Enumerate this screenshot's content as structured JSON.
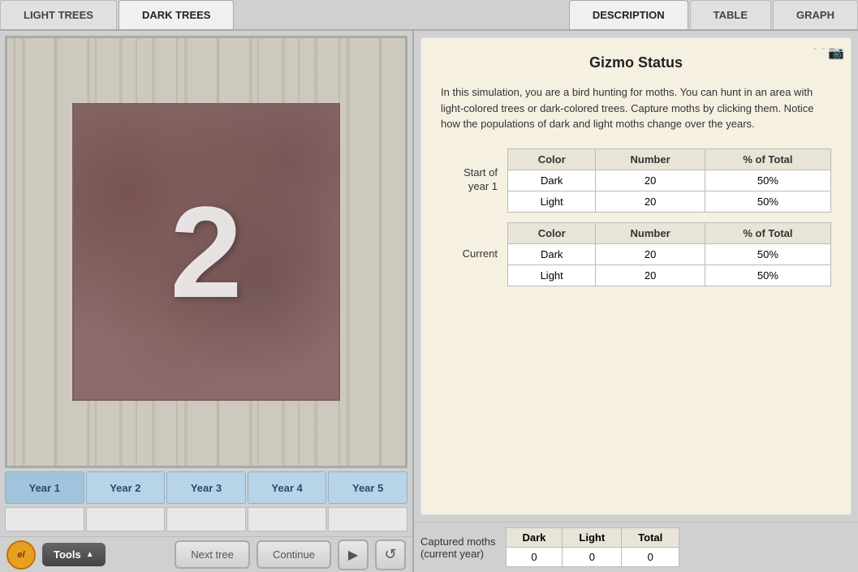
{
  "tabs": {
    "left": [
      {
        "label": "LIGHT TREES",
        "active": false
      },
      {
        "label": "DARK TREES",
        "active": true
      }
    ],
    "right": [
      {
        "label": "DESCRIPTION",
        "active": true
      },
      {
        "label": "TABLE",
        "active": false
      },
      {
        "label": "GRAPH",
        "active": false
      }
    ]
  },
  "display": {
    "current_year": "2"
  },
  "year_tabs": [
    {
      "label": "Year 1"
    },
    {
      "label": "Year 2"
    },
    {
      "label": "Year 3"
    },
    {
      "label": "Year 4"
    },
    {
      "label": "Year 5"
    }
  ],
  "controls": {
    "next_tree": "Next tree",
    "continue": "Continue",
    "tools": "Tools"
  },
  "description": {
    "title": "Gizmo Status",
    "body": "In this simulation, you are a bird hunting for moths. You can hunt in an area with light-colored trees or dark-colored trees. Capture moths by clicking them. Notice how the populations of dark and light moths change over the years."
  },
  "start_table": {
    "label": "Start of\nyear 1",
    "headers": [
      "Color",
      "Number",
      "% of Total"
    ],
    "rows": [
      [
        "Dark",
        "20",
        "50%"
      ],
      [
        "Light",
        "20",
        "50%"
      ]
    ]
  },
  "current_table": {
    "label": "Current",
    "headers": [
      "Color",
      "Number",
      "% of Total"
    ],
    "rows": [
      [
        "Dark",
        "20",
        "50%"
      ],
      [
        "Light",
        "20",
        "50%"
      ]
    ]
  },
  "captured_moths": {
    "label": "Captured moths\n(current year)",
    "headers": [
      "Dark",
      "Light",
      "Total"
    ],
    "values": [
      "0",
      "0",
      "0"
    ]
  }
}
